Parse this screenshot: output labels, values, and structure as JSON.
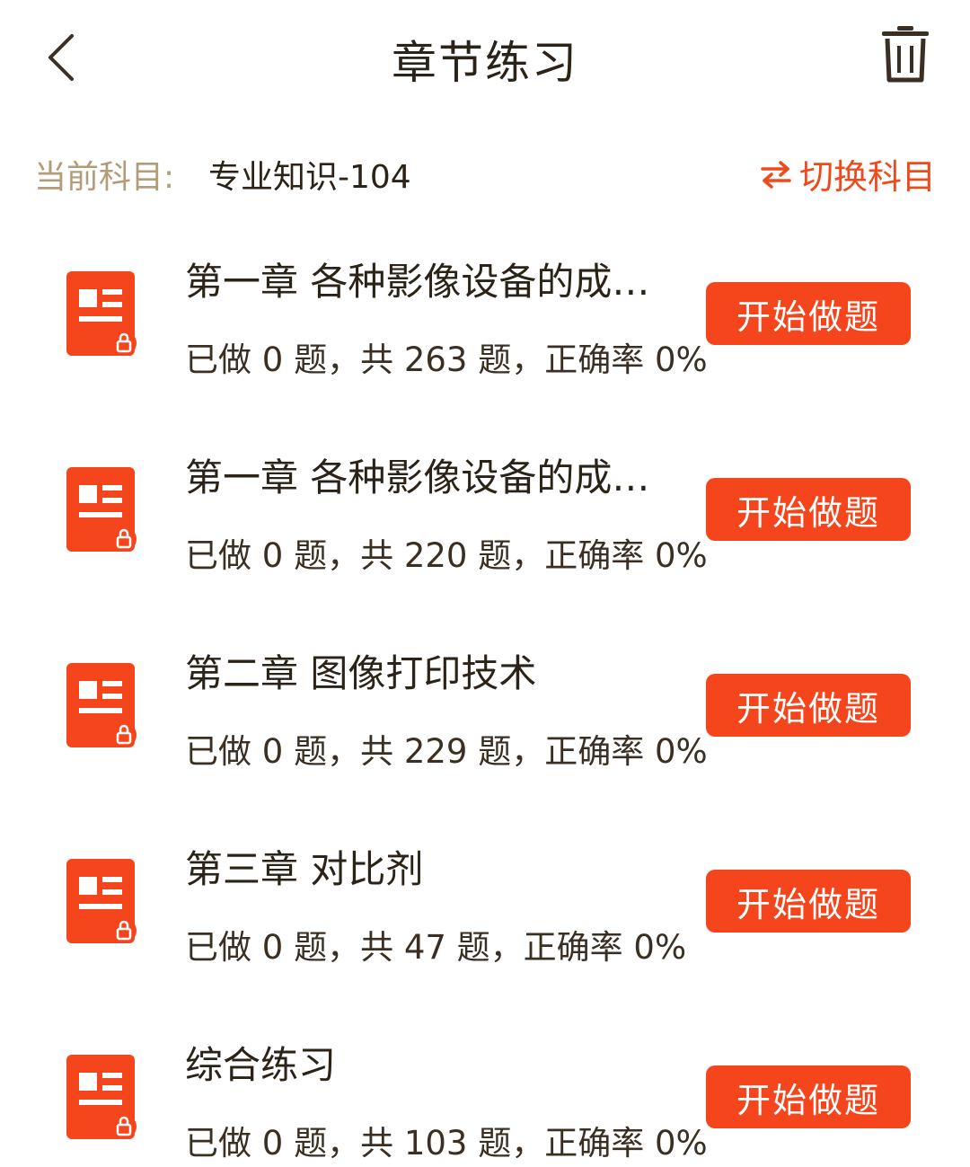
{
  "header": {
    "title": "章节练习",
    "back_icon": "chevron-left-icon",
    "trash_icon": "trash-icon"
  },
  "subject": {
    "label": "当前科目:",
    "value": "专业知识-104",
    "switch_label": "切换科目",
    "switch_icon": "swap-arrows-icon"
  },
  "colors": {
    "accent": "#f4451c",
    "label": "#b39d78",
    "text": "#2b2218"
  },
  "chapters": [
    {
      "title": "第一章 各种影像设备的成…",
      "stats": "已做 0 题，共 263 题，正确率 0%",
      "button": "开始做题"
    },
    {
      "title": "第一章 各种影像设备的成…",
      "stats": "已做 0 题，共 220 题，正确率 0%",
      "button": "开始做题"
    },
    {
      "title": "第二章 图像打印技术",
      "stats": "已做 0 题，共 229 题，正确率 0%",
      "button": "开始做题"
    },
    {
      "title": "第三章 对比剂",
      "stats": "已做 0 题，共 47 题，正确率 0%",
      "button": "开始做题"
    },
    {
      "title": "综合练习",
      "stats": "已做 0 题，共 103 题，正确率 0%",
      "button": "开始做题"
    }
  ]
}
